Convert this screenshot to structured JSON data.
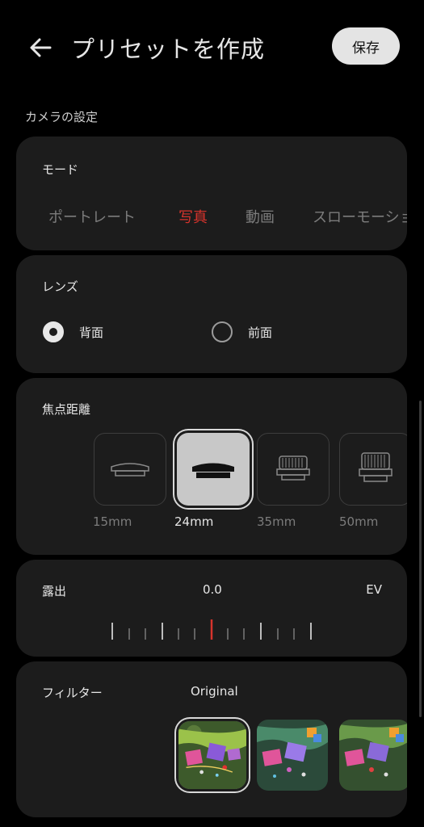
{
  "header": {
    "title": "プリセットを作成",
    "save_label": "保存"
  },
  "section_label": "カメラの設定",
  "mode": {
    "title": "モード",
    "items": [
      "ポートレート",
      "写真",
      "動画",
      "スローモーション"
    ],
    "selected": "写真",
    "accent_color": "#d6332c"
  },
  "lens": {
    "title": "レンズ",
    "options": [
      "背面",
      "前面"
    ],
    "selected": "背面"
  },
  "focal": {
    "title": "焦点距離",
    "options": [
      "15mm",
      "24mm",
      "35mm",
      "50mm"
    ],
    "selected": "24mm"
  },
  "exposure": {
    "title": "露出",
    "value": "0.0",
    "unit": "EV"
  },
  "filter": {
    "title": "フィルター",
    "selected_name": "Original",
    "thumbnail_count_visible": 3
  }
}
